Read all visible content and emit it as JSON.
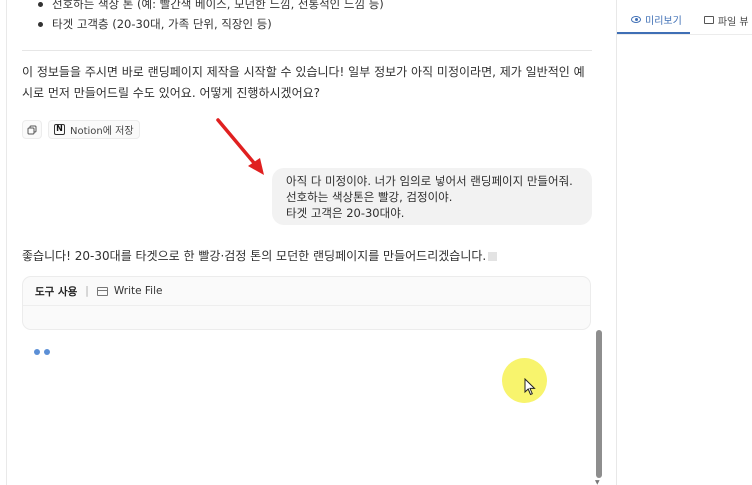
{
  "chat": {
    "bullets": [
      "선호하는 색상 톤 (예: 빨간색 베이스, 모던한 느낌, 전통적인 느낌 등)",
      "타겟 고객층 (20-30대, 가족 단위, 직장인 등)"
    ],
    "assistant_paragraph": "이 정보들을 주시면 바로 랜딩페이지 제작을 시작할 수 있습니다! 일부 정보가 아직 미정이라면, 제가 일반적인 예시로 먼저 만들어드릴 수도 있어요. 어떻게 진행하시겠어요?",
    "actions": {
      "copy_icon": "copy-icon",
      "notion_label": "Notion에 저장"
    },
    "user_message": [
      "아직 다 미정이야. 너가 임의로 넣어서 랜딩페이지 만들어줘.",
      "선호하는 색상톤은 빨강, 검정이야.",
      "타겟 고객은 20-30대야."
    ],
    "assistant_reply": "좋습니다! 20-30대를 타겟으로 한 빨강·검정 톤의 모던한 랜딩페이지를 만들어드리겠습니다.",
    "tool": {
      "label": "도구 사용",
      "separator": "|",
      "name": "Write File"
    }
  },
  "right_panel": {
    "tabs": [
      {
        "label": "미리보기",
        "icon": "eye-icon",
        "active": true
      },
      {
        "label": "파일 뷰",
        "icon": "folder-icon",
        "active": false
      }
    ]
  },
  "colors": {
    "accent": "#3f6fb5",
    "annotation_arrow": "#e02020",
    "cursor_highlight": "#f5f03c",
    "loading_dot": "#5b8fd6"
  }
}
